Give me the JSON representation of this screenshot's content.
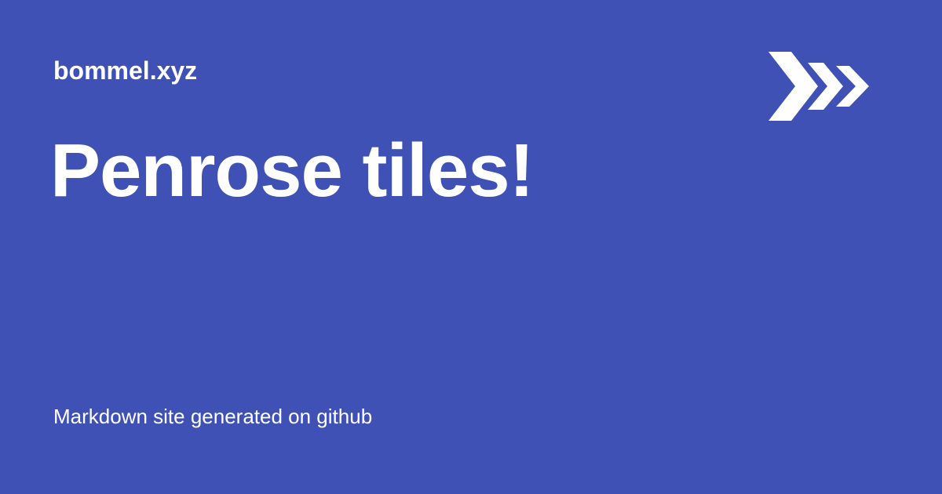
{
  "site": {
    "name": "bommel.xyz"
  },
  "page": {
    "title": "Penrose tiles!"
  },
  "footer": {
    "text": "Markdown site generated on github"
  },
  "logo": {
    "icon": "chevron-arrows-icon"
  },
  "colors": {
    "background": "#3f51b5",
    "text": "#ffffff",
    "logo": "#ffffff"
  }
}
